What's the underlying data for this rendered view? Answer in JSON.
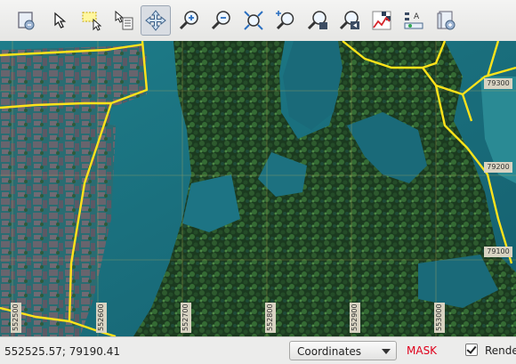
{
  "toolbar": {
    "icons": [
      "new-map-view-icon",
      "pan-arrow-icon",
      "select-feature-icon",
      "identify-feature-icon",
      "pan-map-icon",
      "zoom-in-icon",
      "zoom-out-icon",
      "zoom-full-icon",
      "zoom-to-selection-icon",
      "zoom-to-layer-icon",
      "zoom-last-icon",
      "heatmap-icon",
      "label-tool-icon",
      "new-bookmark-icon"
    ]
  },
  "map": {
    "x_labels": [
      "552500",
      "552600",
      "552700",
      "552800",
      "552900",
      "553000"
    ],
    "y_labels": [
      "79300",
      "79200",
      "79100"
    ]
  },
  "status": {
    "coordinates": "552525.57; 79190.41",
    "display_mode": "Coordinates",
    "mask_label": "MASK",
    "render_label": "Render",
    "render_checked": true
  },
  "colors": {
    "water": "#1e7d8a",
    "vegetation": "#1a3d1d",
    "roads": "#ffe31a",
    "mask_text": "#e0001b"
  }
}
